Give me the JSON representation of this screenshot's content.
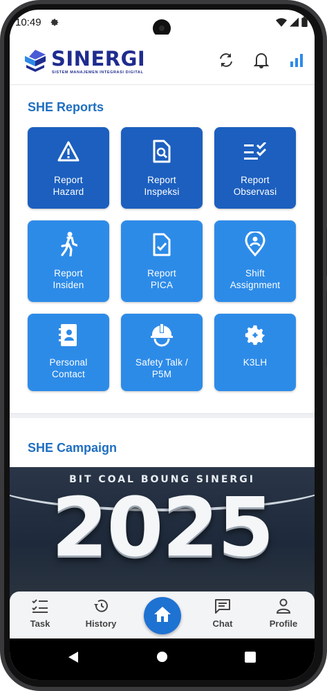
{
  "status_bar": {
    "time": "10:49"
  },
  "header": {
    "brand": "SINERGI",
    "tagline": "SISTEM MANAJEMEN INTEGRASI DIGITAL"
  },
  "she_reports": {
    "title": "SHE Reports",
    "tiles": [
      {
        "line1": "Report",
        "line2": "Hazard",
        "icon": "warning-icon",
        "color": "#1c5fbf"
      },
      {
        "line1": "Report",
        "line2": "Inspeksi",
        "icon": "document-search-icon",
        "color": "#1c5fbf"
      },
      {
        "line1": "Report",
        "line2": "Observasi",
        "icon": "checklist-icon",
        "color": "#1c5fbf"
      },
      {
        "line1": "Report",
        "line2": "Insiden",
        "icon": "walking-person-icon",
        "color": "#2d8be8"
      },
      {
        "line1": "Report",
        "line2": "PICA",
        "icon": "document-check-icon",
        "color": "#2d8be8"
      },
      {
        "line1": "Shift",
        "line2": "Assignment",
        "icon": "location-person-icon",
        "color": "#2d8be8"
      },
      {
        "line1": "Personal",
        "line2": "Contact",
        "icon": "contact-book-icon",
        "color": "#2d8be8"
      },
      {
        "line1": "Safety Talk /",
        "line2": "P5M",
        "icon": "hard-hat-icon",
        "color": "#2d8be8"
      },
      {
        "line1": "K3LH",
        "line2": "",
        "icon": "gear-plus-icon",
        "color": "#2d8be8"
      }
    ]
  },
  "she_campaign": {
    "title": "SHE Campaign",
    "banner_caption": "BIT COAL BOUNG SINERGI",
    "banner_year": "2025"
  },
  "bottom_nav": {
    "task": "Task",
    "history": "History",
    "chat": "Chat",
    "profile": "Profile"
  },
  "colors": {
    "primary": "#1e72d2",
    "brand": "#1f2c8f",
    "section_title": "#1f6fc0"
  }
}
